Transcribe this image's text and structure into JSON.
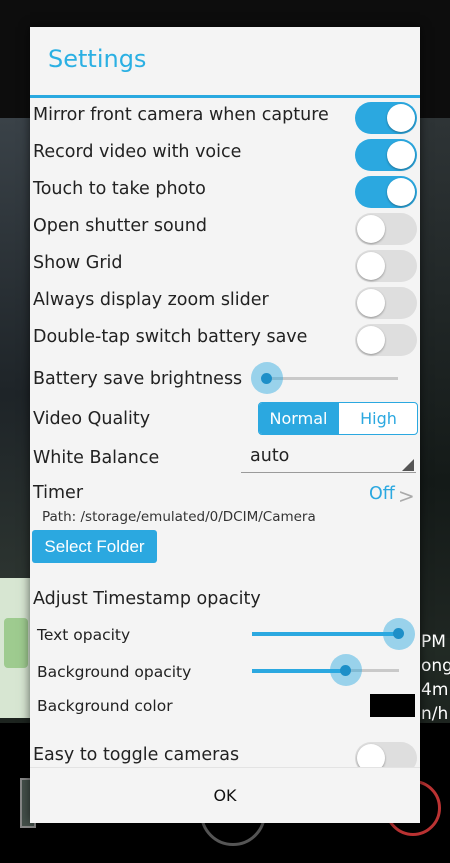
{
  "background": {
    "right_overlay_lines": [
      "PM",
      "ong",
      "4m",
      "n/h"
    ]
  },
  "dialog": {
    "title": "Settings",
    "toggles": [
      {
        "label": "Mirror front camera when capture",
        "on": true
      },
      {
        "label": "Record video with voice",
        "on": true
      },
      {
        "label": "Touch to take photo",
        "on": true
      },
      {
        "label": "Open shutter sound",
        "on": false
      },
      {
        "label": "Show Grid",
        "on": false
      },
      {
        "label": "Always display zoom slider",
        "on": false
      },
      {
        "label": "Double-tap switch battery save",
        "on": false
      }
    ],
    "battery_brightness": {
      "label": "Battery save brightness",
      "value_fraction": 0.0
    },
    "video_quality": {
      "label": "Video Quality",
      "options": [
        "Normal",
        "High"
      ],
      "selected": "Normal"
    },
    "white_balance": {
      "label": "White Balance",
      "value": "auto"
    },
    "timer": {
      "label": "Timer",
      "value": "Off",
      "chevron": ">"
    },
    "path": "Path: /storage/emulated/0/DCIM/Camera",
    "select_folder_label": "Select Folder",
    "timestamp": {
      "heading": "Adjust Timestamp opacity",
      "text_opacity": {
        "label": "Text opacity",
        "value_fraction": 1.0
      },
      "background_opacity": {
        "label": "Background opacity",
        "value_fraction": 0.63
      },
      "background_color": {
        "label": "Background color",
        "value": "#000000"
      }
    },
    "easy_toggle": {
      "label": "Easy to toggle cameras",
      "on": false
    },
    "ok_label": "OK"
  },
  "colors": {
    "accent": "#2ba8e0",
    "title": "#2bb0e3"
  }
}
